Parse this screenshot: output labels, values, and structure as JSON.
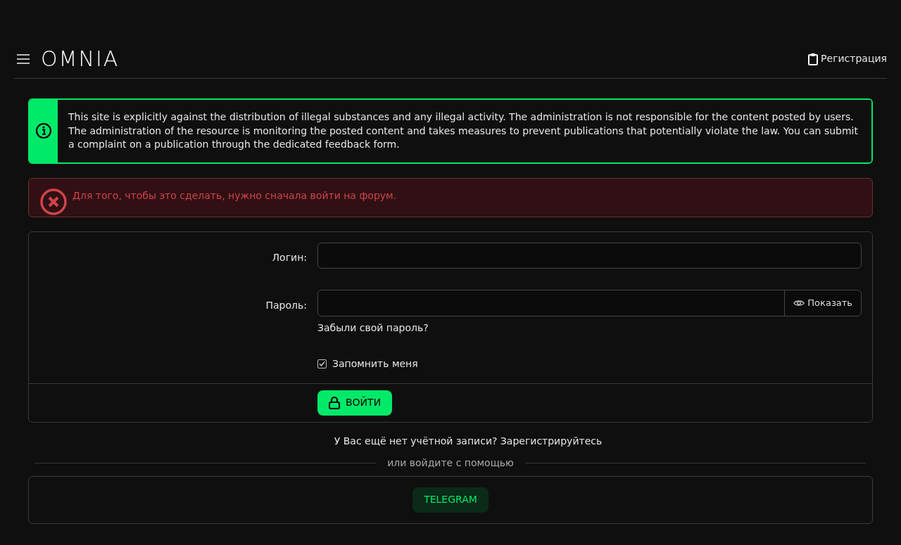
{
  "header": {
    "logo": "OMNIA",
    "register_link": "Регистрация"
  },
  "notice": {
    "text": "This site is explicitly against the distribution of illegal substances and any illegal activity. The administration is not responsible for the content posted by users. The administration of the resource is monitoring the posted content and takes measures to prevent publications that potentially violate the law. You can submit a complaint on a publication through the dedicated feedback form."
  },
  "error": {
    "text": "Для того, чтобы это сделать, нужно сначала войти на форум."
  },
  "login_form": {
    "login_label": "Логин:",
    "password_label": "Пароль:",
    "show_button": "Показать",
    "forgot_link": "Забыли свой пароль?",
    "remember": {
      "label": "Запомнить меня",
      "checked": true
    },
    "submit_button": "ВОЙТИ"
  },
  "register_prompt": "У Вас ещё нет учётной записи? Зарегистрируйтесь",
  "divider_text": "или войдите с помощью",
  "social_buttons": [
    "TELEGRAM"
  ]
}
